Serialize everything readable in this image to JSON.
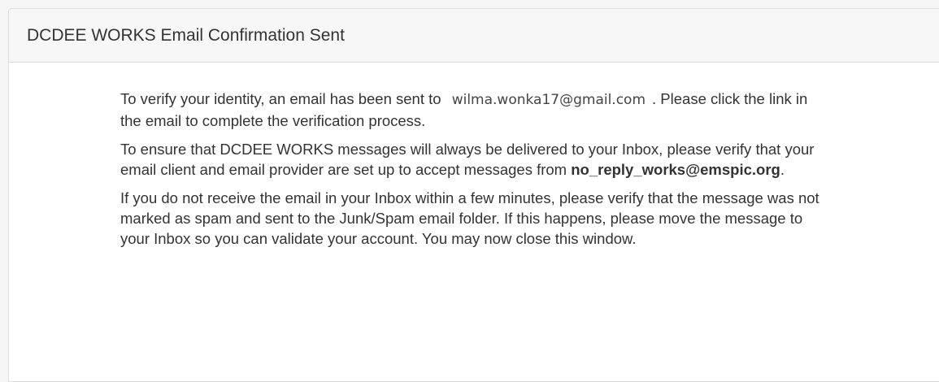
{
  "panel": {
    "title": "DCDEE WORKS Email Confirmation Sent"
  },
  "message": {
    "p1_before": "To verify your identity, an email has been sent to",
    "email": "wilma.wonka17@gmail.com",
    "p1_after": ". Please click the link in the email to complete the verification process.",
    "p2_text": "To ensure that DCDEE WORKS messages will always be delivered to your Inbox, please verify that your email client and email provider are set up to accept messages from",
    "p2_sender": "no_reply_works@emspic.org",
    "p2_end": ".",
    "p3_text": "If you do not receive the email in your Inbox within a few minutes, please verify that the message was not marked as spam and sent to the Junk/Spam email folder. If this happens, please move the message to your Inbox so you can validate your account. You may now close this window."
  }
}
